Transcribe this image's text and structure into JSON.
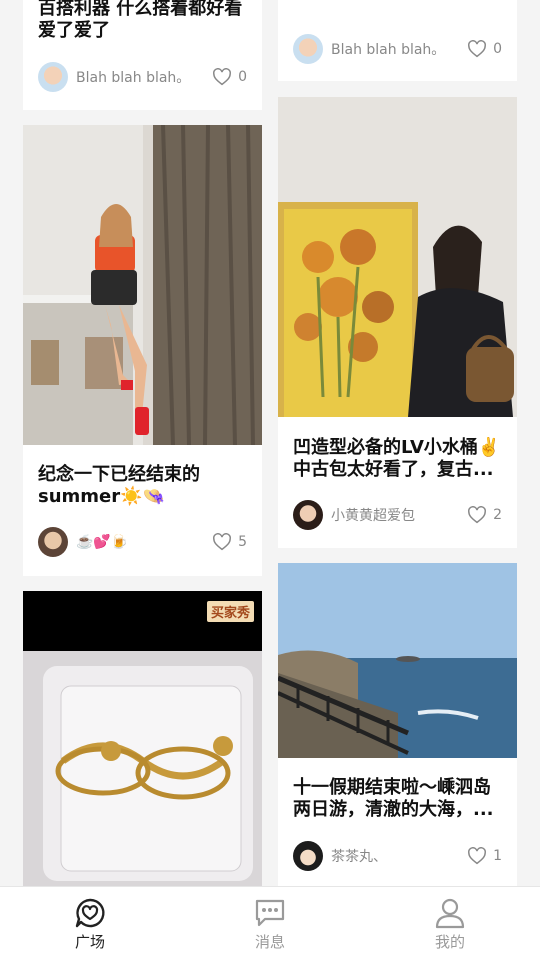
{
  "cards": [
    {
      "title": "百搭利器 什么搭着都好看 爱了爱了",
      "author": "Blah blah blah。",
      "likes": "0"
    },
    {
      "title": "",
      "author": "Blah blah blah。",
      "likes": "0"
    },
    {
      "title": "纪念一下已经结束的summer☀️👒",
      "author": "☕️💕🍺",
      "likes": "5"
    },
    {
      "title": "凹造型必备的LV小水桶✌️中古包太好看了，复古...",
      "author": "小黄黄超爱包",
      "likes": "2"
    },
    {
      "title": "",
      "author": "",
      "likes": "",
      "badge": "买家秀"
    },
    {
      "title": "十一假期结束啦～嵊泗岛两日游，清澈的大海，...",
      "author": "茶茶丸、",
      "likes": "1"
    }
  ],
  "tabbar": {
    "items": [
      {
        "label": "广场",
        "icon": "heart-chat-icon",
        "active": true
      },
      {
        "label": "消息",
        "icon": "message-icon",
        "active": false
      },
      {
        "label": "我的",
        "icon": "profile-icon",
        "active": false
      }
    ],
    "active_color": "#222222",
    "inactive_color": "#9a9a9a"
  }
}
